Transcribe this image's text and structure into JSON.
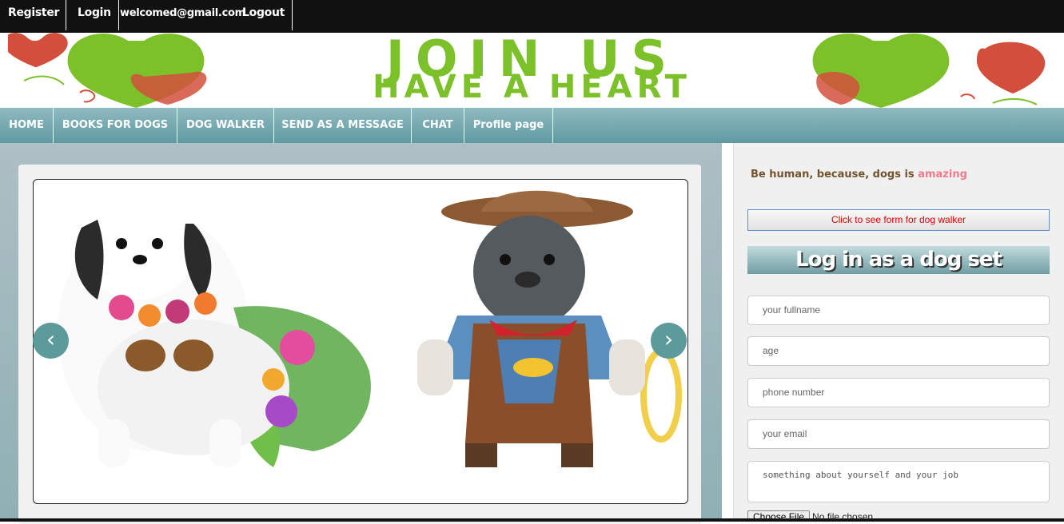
{
  "topbar": {
    "register": "Register",
    "login": "Login",
    "email": "welcomed@gmail.com",
    "logout": "Logout"
  },
  "banner": {
    "line1": "JOIN US",
    "line2": "HAVE A HEART",
    "heart_green": "#7cc12a",
    "heart_red": "#d24f3c"
  },
  "nav": {
    "items": [
      "HOME",
      "BOOKS FOR DOGS",
      "DOG WALKER",
      "SEND AS A MESSAGE",
      "CHAT",
      "Profile page"
    ]
  },
  "slider": {
    "prev": "‹",
    "next": "›"
  },
  "side": {
    "tagline": "Be human, because, dogs is",
    "tagline_accent": "amazing",
    "walker_button": "Click to see form for dog walker",
    "form_title": "Log in as a dog set",
    "fields": {
      "fullname": "your fullname",
      "age": "age",
      "phone": "phone number",
      "email": "your email"
    },
    "about": "something about yourself and your job",
    "file_button": "Choose File",
    "file_status": "No file chosen"
  }
}
